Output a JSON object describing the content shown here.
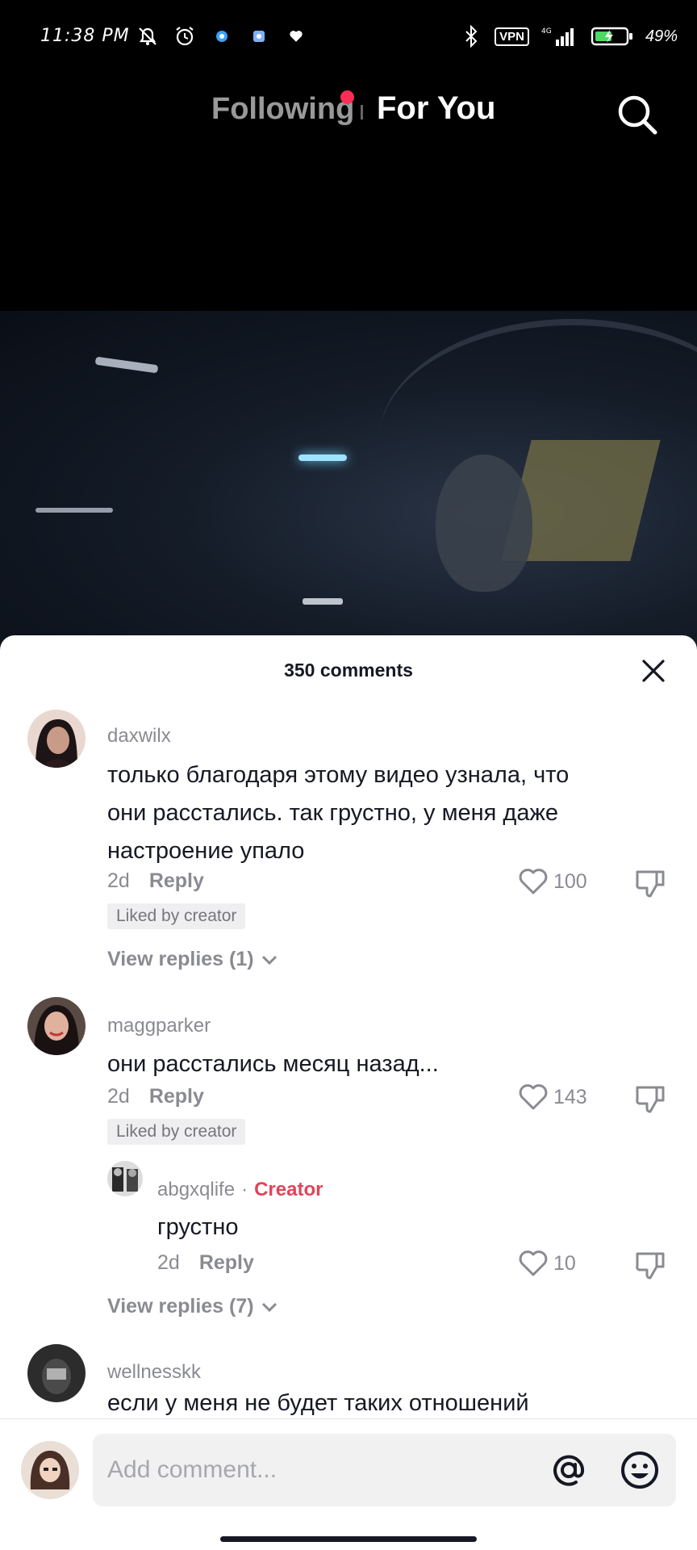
{
  "status_bar": {
    "time": "11:38 PM",
    "vpn_label": "VPN",
    "network": "4G",
    "battery": "49%",
    "icons_left": [
      "mute-bell-icon",
      "alarm-icon",
      "app-notification-icon",
      "app-notification-icon",
      "heart-icon"
    ],
    "icons_right": [
      "bluetooth-icon",
      "vpn-icon",
      "signal-icon",
      "battery-icon"
    ]
  },
  "nav": {
    "tab_following": "Following",
    "tab_foryou": "For You",
    "search_icon": "search-icon",
    "active_tab": "For You",
    "notification_dot_color": "#ff2d55"
  },
  "comments_panel": {
    "title": "350 comments",
    "close_icon": "close-icon"
  },
  "comments": [
    {
      "user": "daxwilx",
      "text": "только благодаря этому видео узнала, что они расстались. так грустно, у меня даже настроение упало",
      "time": "2d",
      "reply_label": "Reply",
      "likes": "100",
      "liked_by_creator": "Liked by creator",
      "view_replies": "View replies (1)"
    },
    {
      "user": "maggparker",
      "text": "они расстались месяц назад...",
      "time": "2d",
      "reply_label": "Reply",
      "likes": "143",
      "liked_by_creator": "Liked by creator",
      "view_replies": "View replies (7)",
      "reply": {
        "user": "abgxqlife",
        "separator": "·",
        "badge": "Creator",
        "text": "грустно",
        "time": "2d",
        "reply_label": "Reply",
        "likes": "10"
      }
    },
    {
      "user": "wellnesskk",
      "text": "если у меня не будет таких отношений"
    }
  ],
  "composer": {
    "placeholder": "Add comment...",
    "mention_icon": "at-icon",
    "emoji_icon": "emoji-icon"
  },
  "colors": {
    "creator_badge": "#e0445a",
    "text_primary": "#161823",
    "text_secondary": "#8a8b91"
  }
}
